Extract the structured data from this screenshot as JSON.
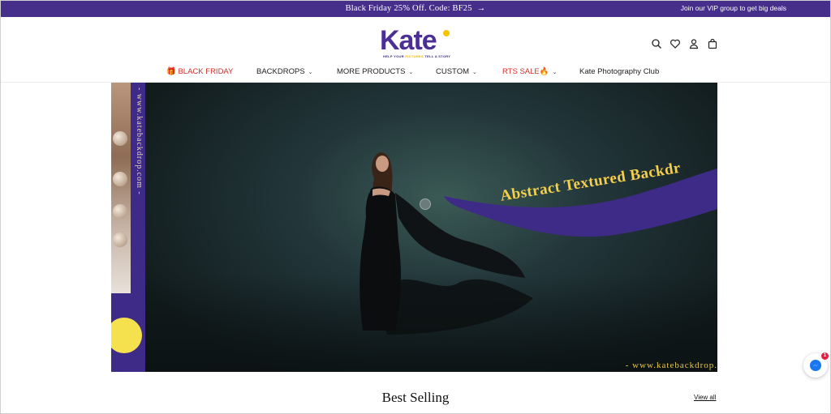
{
  "announcement": {
    "promo_text": "Black Friday 25% Off. Code: BF25",
    "arrow": "→",
    "vip_text": "Join our VIP group to get big deals",
    "background": "#452f8b"
  },
  "brand": {
    "logo_text": "Kate",
    "tagline_a": "HELP YOUR",
    "tagline_b": "PICTURES",
    "tagline_c": "TELL A STORY",
    "brand_color": "#4b2f97",
    "accent_color": "#f6c400"
  },
  "header_icons": [
    "search-icon",
    "heart-icon",
    "account-icon",
    "cart-icon"
  ],
  "nav": {
    "items": [
      {
        "label": "🎁 BLACK FRIDAY",
        "has_dropdown": false,
        "color": "#d0312d"
      },
      {
        "label": "BACKDROPS",
        "has_dropdown": true,
        "color": "#222222"
      },
      {
        "label": "MORE PRODUCTS",
        "has_dropdown": true,
        "color": "#222222"
      },
      {
        "label": "CUSTOM",
        "has_dropdown": true,
        "color": "#222222"
      },
      {
        "label": "RTS SALE🔥",
        "has_dropdown": true,
        "color": "#d0312d"
      },
      {
        "label": "Kate Photography Club",
        "has_dropdown": false,
        "color": "#222222"
      }
    ],
    "chevron": "⌄"
  },
  "hero": {
    "vertical_url": "- www.katebackdrop.com -",
    "banner_text": "Abstract  Textured Backdr",
    "bottom_url": "- www.katebackdrop."
  },
  "best_selling": {
    "title": "Best Selling",
    "view_all": "View all"
  },
  "messenger": {
    "badge_count": "1"
  }
}
